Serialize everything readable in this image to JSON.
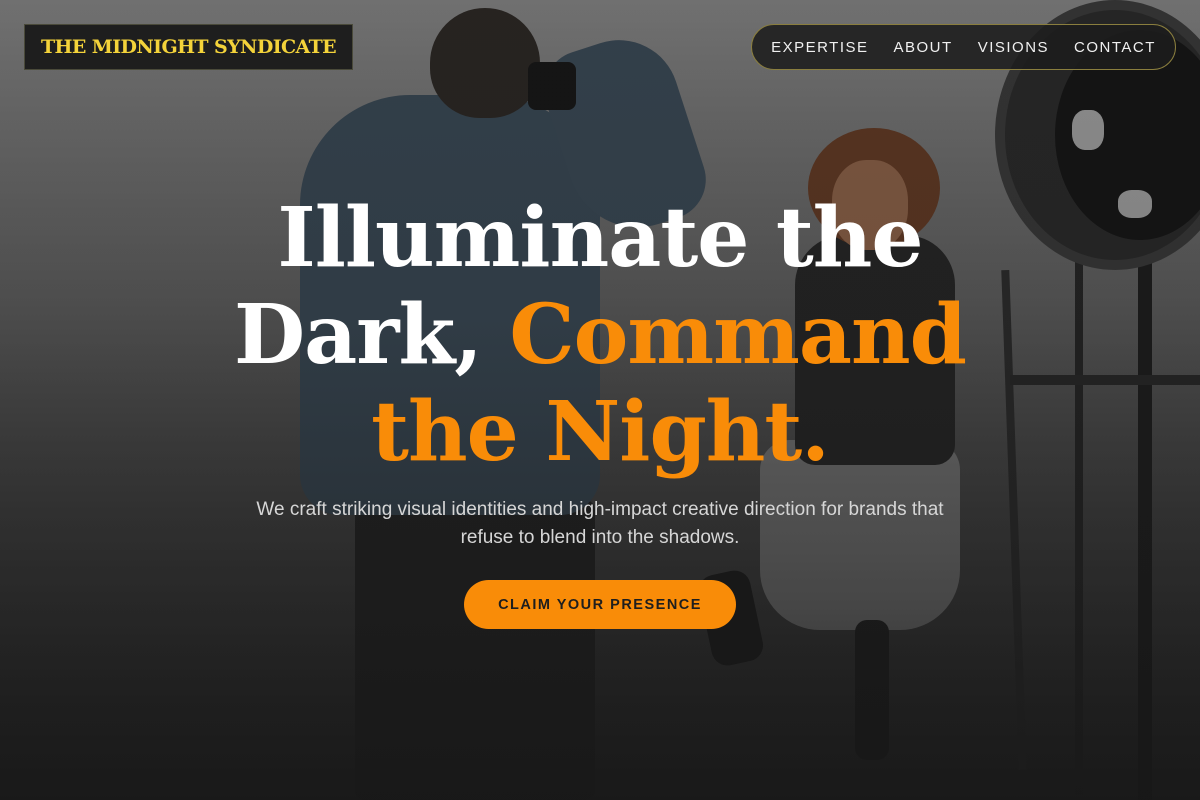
{
  "brand": {
    "logo_text": "THE MIDNIGHT SYNDICATE",
    "logo_color": "#f4d33a"
  },
  "nav": {
    "items": [
      {
        "label": "EXPERTISE"
      },
      {
        "label": "ABOUT"
      },
      {
        "label": "VISIONS"
      },
      {
        "label": "CONTACT"
      }
    ]
  },
  "hero": {
    "headline_line1": "Illuminate the",
    "headline_line2_plain": "Dark,",
    "headline_line2_accent": "Command",
    "headline_line3_accent": "the Night.",
    "subtitle": "We craft striking visual identities and high-impact creative direction for brands that refuse to blend into the shadows.",
    "cta_label": "CLAIM YOUR PRESENCE",
    "accent_color": "#f98c08"
  }
}
